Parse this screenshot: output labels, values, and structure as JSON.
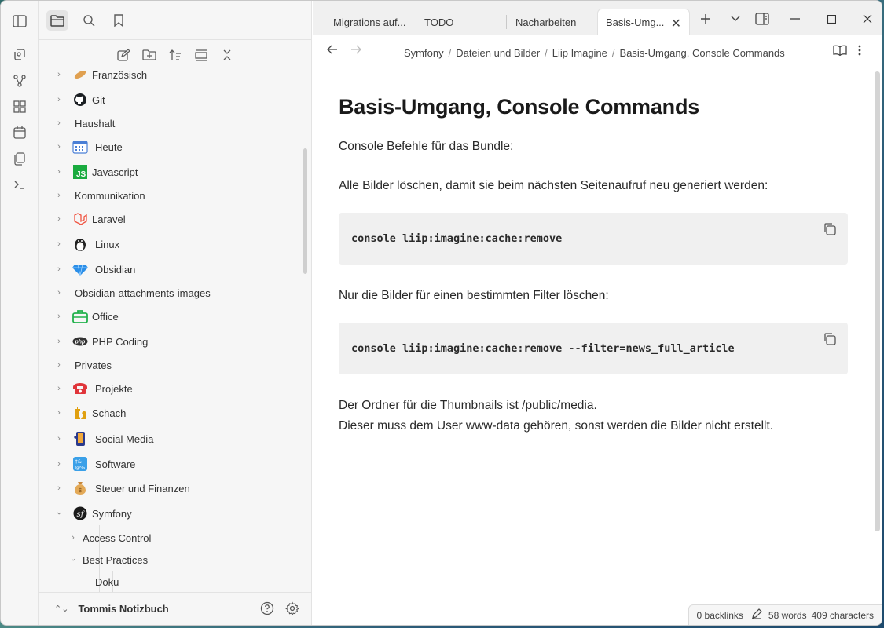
{
  "sidebar": {
    "items": [
      {
        "label": "Französisch",
        "icon": "baguette-icon",
        "expanded": false
      },
      {
        "label": "Git",
        "icon": "github-icon",
        "expanded": false
      },
      {
        "label": "Haushalt",
        "icon": "",
        "expanded": false
      },
      {
        "label": "Heute",
        "icon": "calendar-icon",
        "expanded": false
      },
      {
        "label": "Javascript",
        "icon": "js-icon",
        "expanded": false
      },
      {
        "label": "Kommunikation",
        "icon": "",
        "expanded": false
      },
      {
        "label": "Laravel",
        "icon": "laravel-icon",
        "expanded": false
      },
      {
        "label": "Linux",
        "icon": "penguin-icon",
        "expanded": false
      },
      {
        "label": "Obsidian",
        "icon": "gem-icon",
        "expanded": false
      },
      {
        "label": "Obsidian-attachments-images",
        "icon": "",
        "expanded": false
      },
      {
        "label": "Office",
        "icon": "briefcase-icon",
        "expanded": false
      },
      {
        "label": "PHP Coding",
        "icon": "php-icon",
        "expanded": false
      },
      {
        "label": "Privates",
        "icon": "",
        "expanded": false
      },
      {
        "label": "Projekte",
        "icon": "telephone-icon",
        "expanded": false
      },
      {
        "label": "Schach",
        "icon": "chess-icon",
        "expanded": false
      },
      {
        "label": "Social Media",
        "icon": "mobile-icon",
        "expanded": false
      },
      {
        "label": "Software",
        "icon": "symbols-icon",
        "expanded": false
      },
      {
        "label": "Steuer und Finanzen",
        "icon": "money-bag-icon",
        "expanded": false
      },
      {
        "label": "Symfony",
        "icon": "symfony-icon",
        "expanded": true
      }
    ],
    "subitems": [
      {
        "label": "Access Control",
        "expanded": false
      },
      {
        "label": "Best Practices",
        "expanded": true
      }
    ],
    "leaf": "Doku",
    "vault_name": "Tommis Notizbuch"
  },
  "tabs": [
    {
      "label": "Migrations auf..."
    },
    {
      "label": "TODO"
    },
    {
      "label": "Nacharbeiten"
    },
    {
      "label": "Basis-Umg..."
    }
  ],
  "breadcrumb": [
    "Symfony",
    "Dateien und Bilder",
    "Liip Imagine",
    "Basis-Umgang, Console Commands"
  ],
  "note": {
    "title": "Basis-Umgang, Console Commands",
    "p1": "Console Befehle für das Bundle:",
    "p2": "Alle Bilder löschen, damit sie beim nächsten Seitenaufruf neu generiert werden:",
    "code1": "console liip:imagine:cache:remove",
    "p3": "Nur die Bilder für einen bestimmten Filter löschen:",
    "code2": "console liip:imagine:cache:remove --filter=news_full_article",
    "p4a": "Der Ordner für die Thumbnails ist /public/media.",
    "p4b": "Dieser muss dem User www-data gehören, sonst werden die Bilder nicht erstellt."
  },
  "status": {
    "backlinks": "0 backlinks",
    "words": "58 words",
    "characters": "409 characters"
  }
}
